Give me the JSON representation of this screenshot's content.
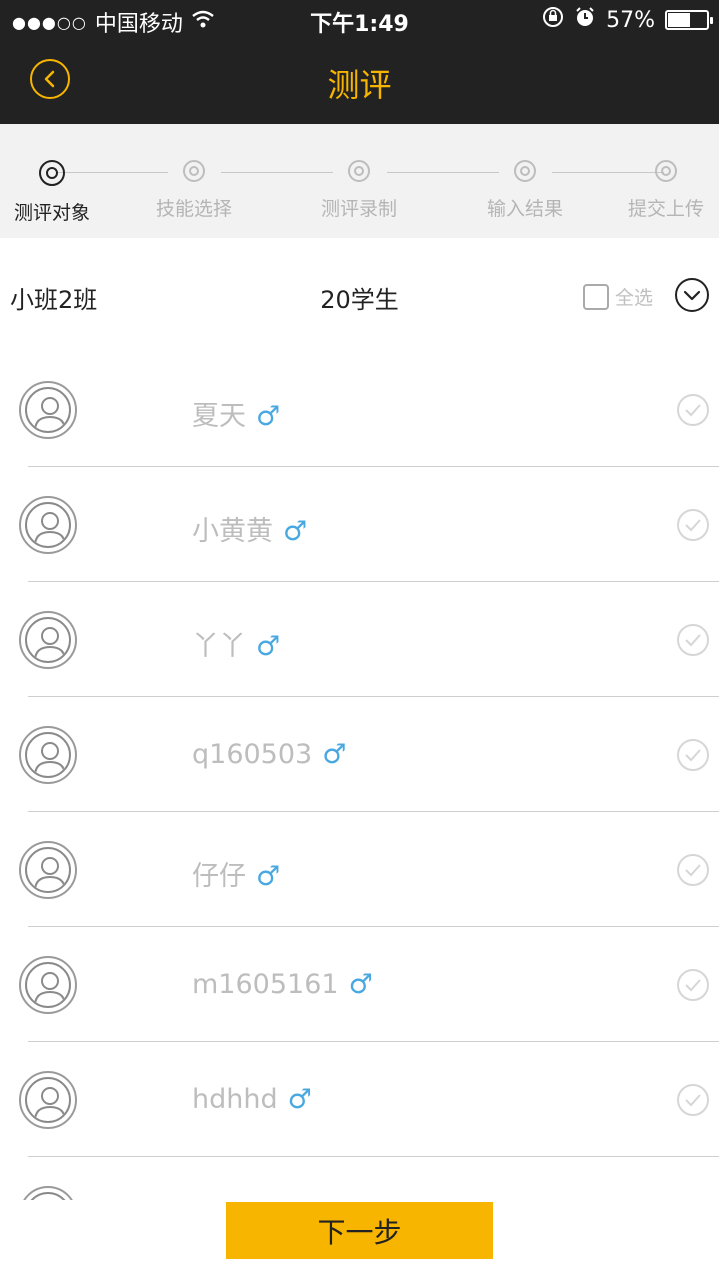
{
  "status_bar": {
    "signal_dots": "●●●○○",
    "carrier": "中国移动",
    "time": "下午1:49",
    "battery_percent": "57%",
    "battery_level": 0.57
  },
  "nav": {
    "title": "测评",
    "accent_color": "#f7b500"
  },
  "steps": [
    {
      "label": "测评对象",
      "active": true
    },
    {
      "label": "技能选择",
      "active": false
    },
    {
      "label": "测评录制",
      "active": false
    },
    {
      "label": "输入结果",
      "active": false
    },
    {
      "label": "提交上传",
      "active": false
    }
  ],
  "class_info": {
    "class_name": "小班2班",
    "student_count": "20学生",
    "select_all_label": "全选"
  },
  "students": [
    {
      "name": "夏天",
      "gender_symbol": "♂"
    },
    {
      "name": "小黄黄",
      "gender_symbol": "♂"
    },
    {
      "name": "丫丫",
      "gender_symbol": "♂"
    },
    {
      "name": "q160503",
      "gender_symbol": "♂"
    },
    {
      "name": "仔仔",
      "gender_symbol": "♂"
    },
    {
      "name": "m1605161",
      "gender_symbol": "♂"
    },
    {
      "name": "hdhhd",
      "gender_symbol": "♂"
    }
  ],
  "footer": {
    "next_label": "下一步"
  }
}
